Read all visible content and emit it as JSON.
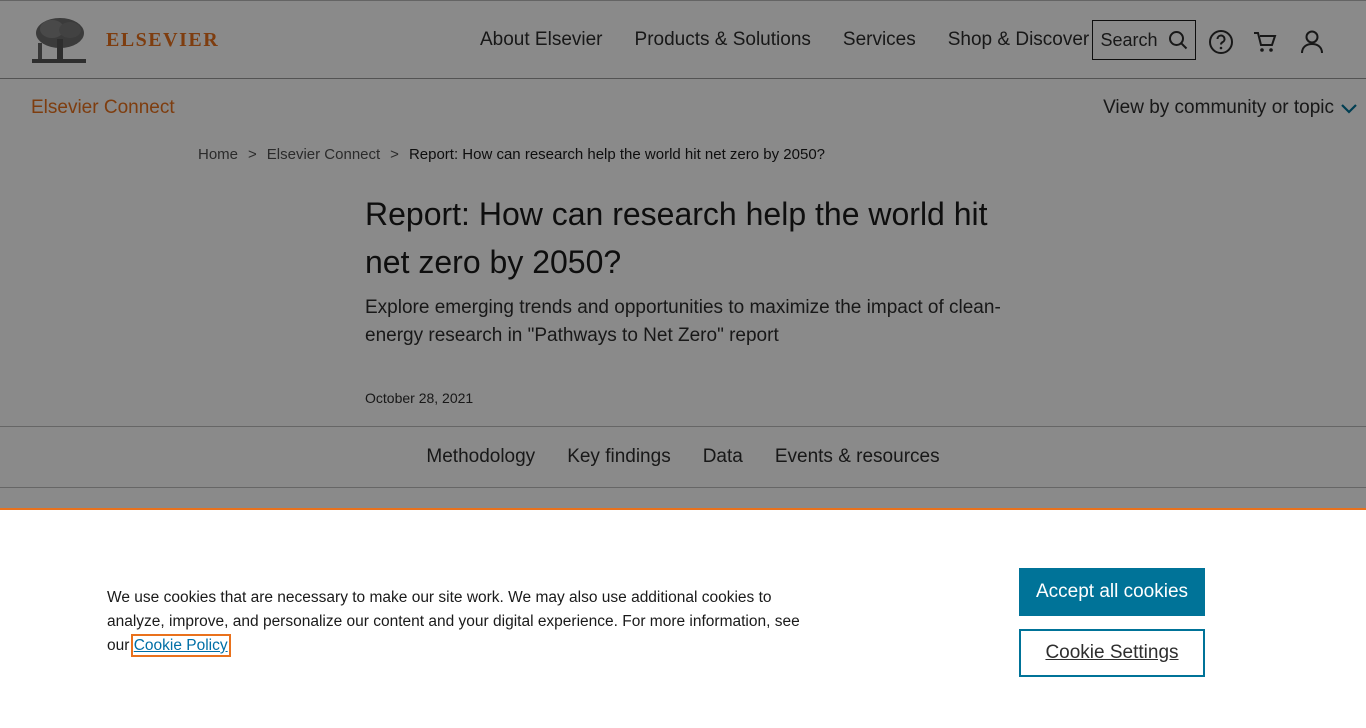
{
  "header": {
    "logo_text": "ELSEVIER",
    "nav": [
      "About Elsevier",
      "Products & Solutions",
      "Services",
      "Shop & Discover"
    ],
    "search_label": "Search"
  },
  "subheader": {
    "connect_label": "Elsevier Connect",
    "view_by_label": "View by community or topic"
  },
  "breadcrumb": [
    "Home",
    "Elsevier Connect",
    "Report: How can research help the world hit net zero by 2050?"
  ],
  "breadcrumb_sep": ">",
  "article": {
    "title": "Report: How can research help the world hit net zero by 2050?",
    "subtitle": "Explore emerging trends and opportunities to maximize the impact of clean-energy research in \"Pathways to Net Zero\" report",
    "date": "October 28, 2021"
  },
  "tabs": [
    "Methodology",
    "Key findings",
    "Data",
    "Events & resources"
  ],
  "cookie": {
    "text": "We use cookies that are necessary to make our site work. We may also use additional cookies to analyze, improve, and personalize our content and your digital experience. For more information, see our ",
    "link_label": "Cookie Policy",
    "accept_label": "Accept all cookies",
    "settings_label": "Cookie Settings"
  },
  "colors": {
    "brand_orange": "#e9711c",
    "accent_blue": "#007398"
  },
  "icons": [
    "search-icon",
    "help-icon",
    "cart-icon",
    "user-icon",
    "chevron-down-icon"
  ]
}
